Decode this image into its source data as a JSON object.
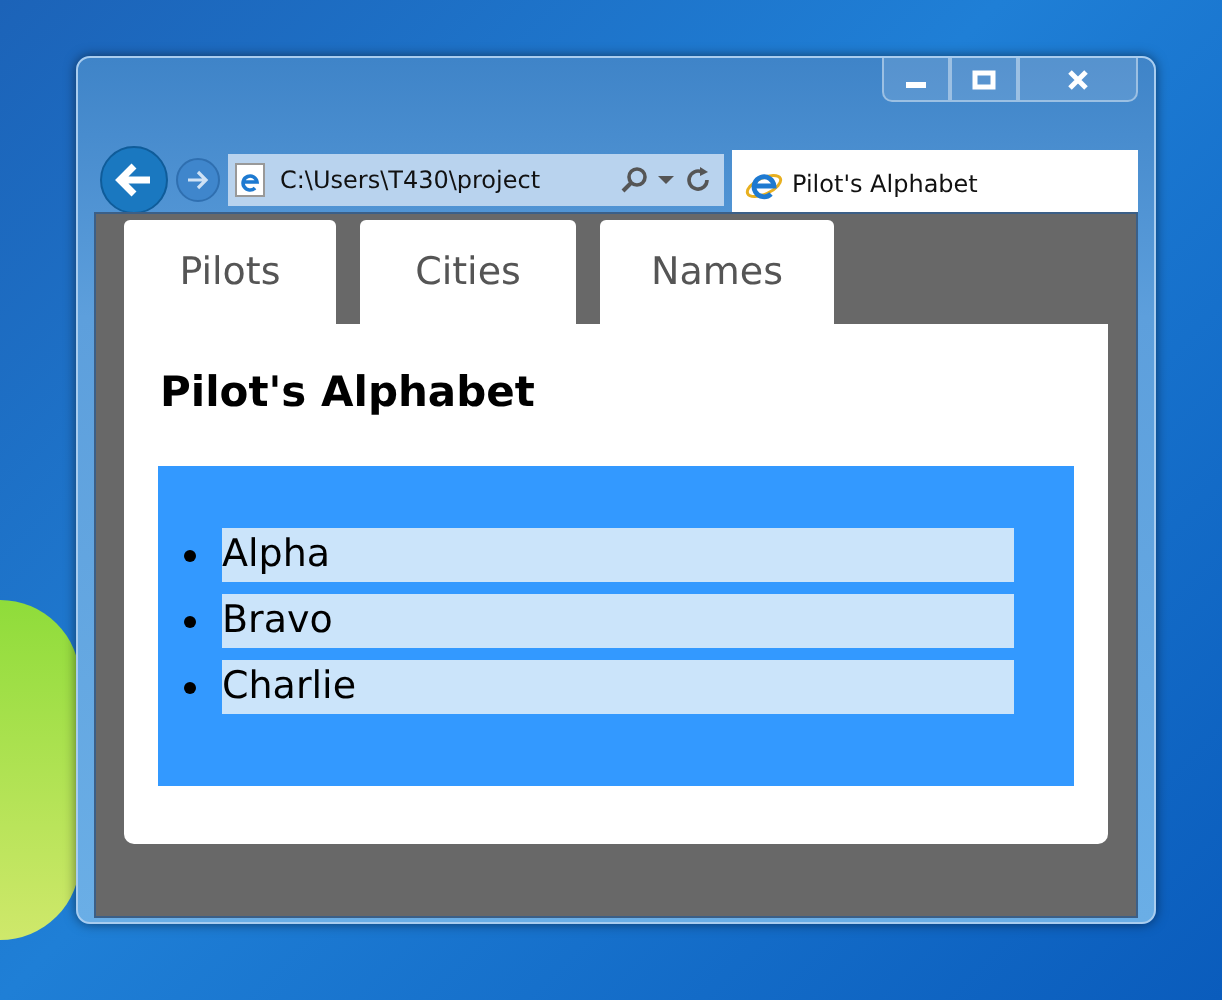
{
  "window": {
    "address": "C:\\Users\\T430\\project",
    "browser_tab": "Pilot's Alphabet"
  },
  "tabs": [
    {
      "label": "Pilots"
    },
    {
      "label": "Cities"
    },
    {
      "label": "Names"
    }
  ],
  "page": {
    "heading": "Pilot's Alphabet",
    "items": [
      "Alpha",
      "Bravo",
      "Charlie"
    ]
  }
}
